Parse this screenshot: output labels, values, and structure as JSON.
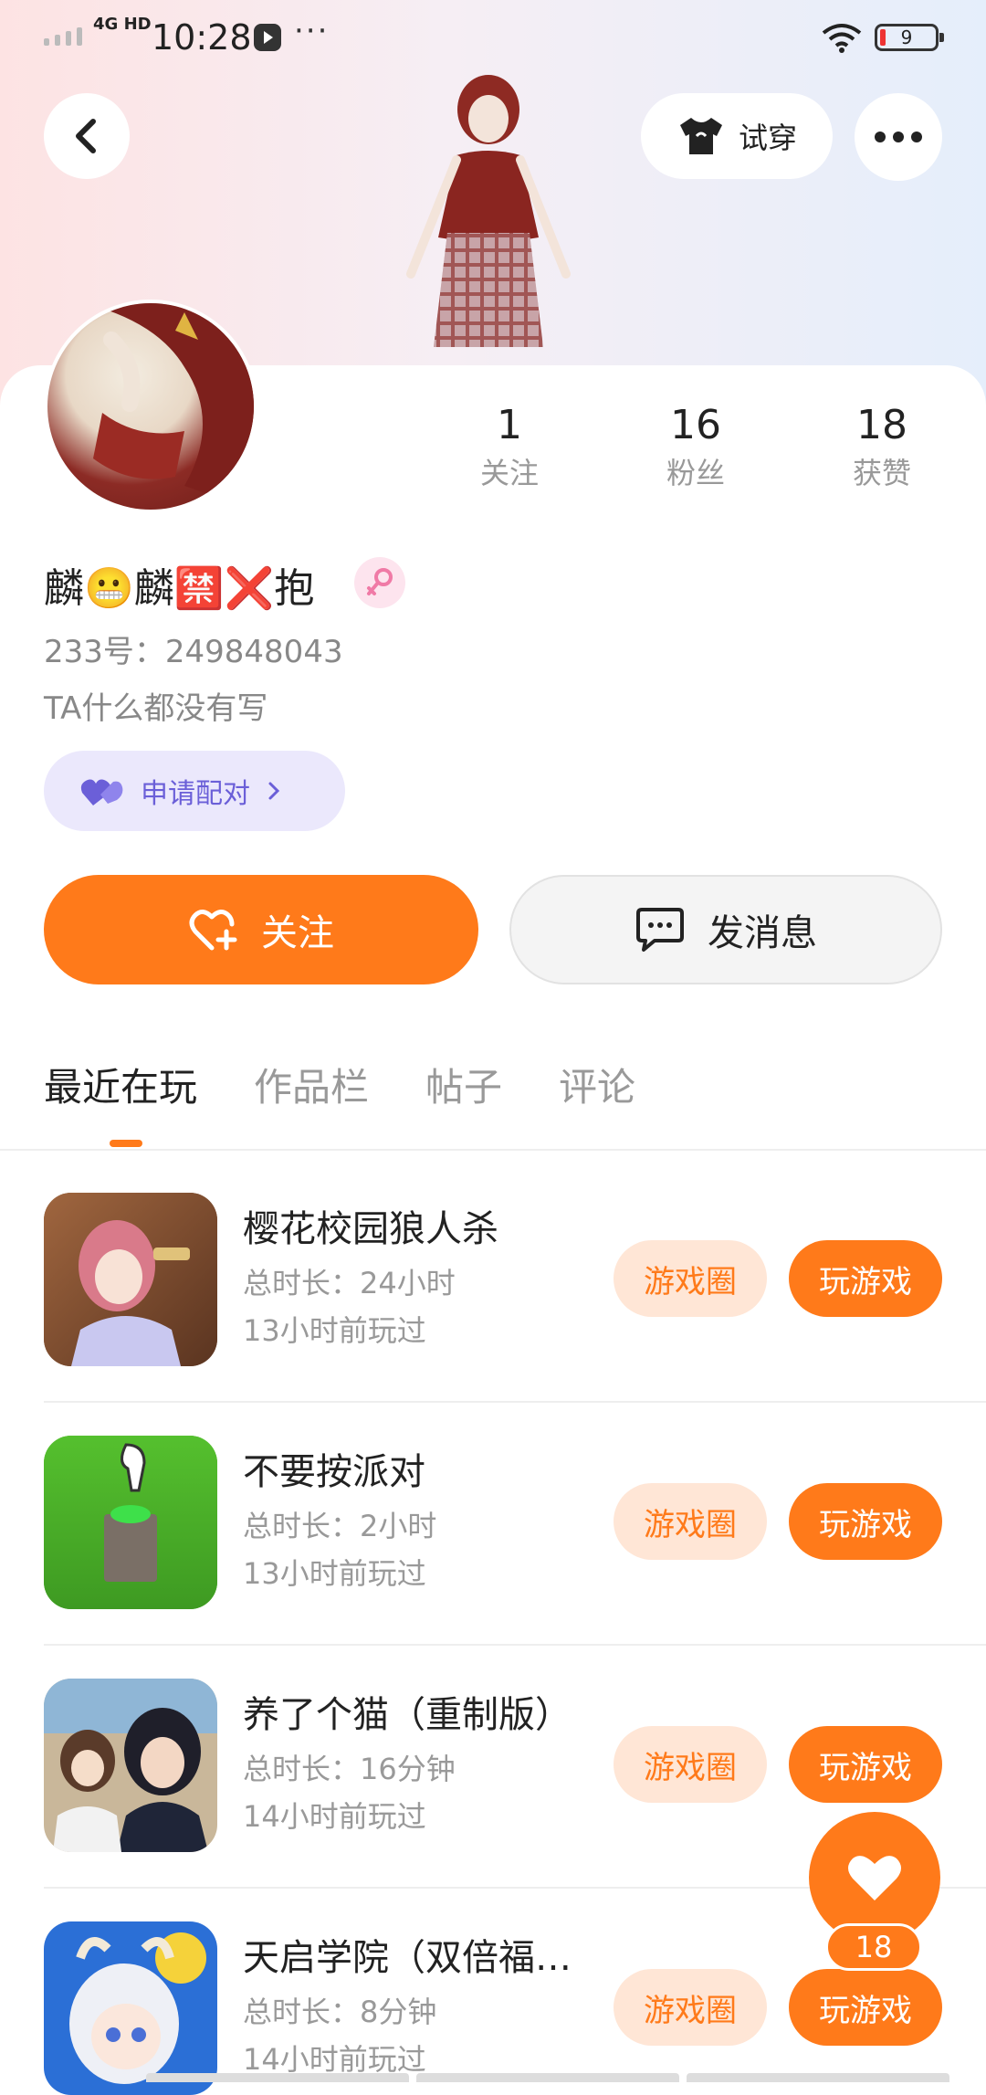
{
  "status": {
    "network": "4G HD",
    "time": "10:28",
    "more": "···",
    "battery": "9"
  },
  "header": {
    "tryon_label": "试穿"
  },
  "stats": [
    {
      "num": "1",
      "label": "关注"
    },
    {
      "num": "16",
      "label": "粉丝"
    },
    {
      "num": "18",
      "label": "获赞"
    }
  ],
  "profile": {
    "name": "麟😬麟🈲❌抱",
    "uid": "233号：249848043",
    "bio": "TA什么都没有写",
    "pair_label": "申请配对"
  },
  "actions": {
    "follow": "关注",
    "message": "发消息"
  },
  "tabs": [
    "最近在玩",
    "作品栏",
    "帖子",
    "评论"
  ],
  "games": [
    {
      "title": "樱花校园狼人杀",
      "duration": "总时长：24小时",
      "last_played": "13小时前玩过",
      "circle_label": "游戏圈",
      "play_label": "玩游戏"
    },
    {
      "title": "不要按派对",
      "duration": "总时长：2小时",
      "last_played": "13小时前玩过",
      "circle_label": "游戏圈",
      "play_label": "玩游戏"
    },
    {
      "title": "养了个猫（重制版）",
      "duration": "总时长：16分钟",
      "last_played": "14小时前玩过",
      "circle_label": "游戏圈",
      "play_label": "玩游戏"
    },
    {
      "title": "天启学院（双倍福…",
      "duration": "总时长：8分钟",
      "last_played": "14小时前玩过",
      "circle_label": "游戏圈",
      "play_label": "玩游戏"
    }
  ],
  "fab": {
    "count": "18"
  },
  "colors": {
    "accent": "#ff7a1a",
    "accent_light": "#ffe6d6",
    "pair_bg": "#ebe8fc",
    "pair_text": "#6b5fd8"
  }
}
